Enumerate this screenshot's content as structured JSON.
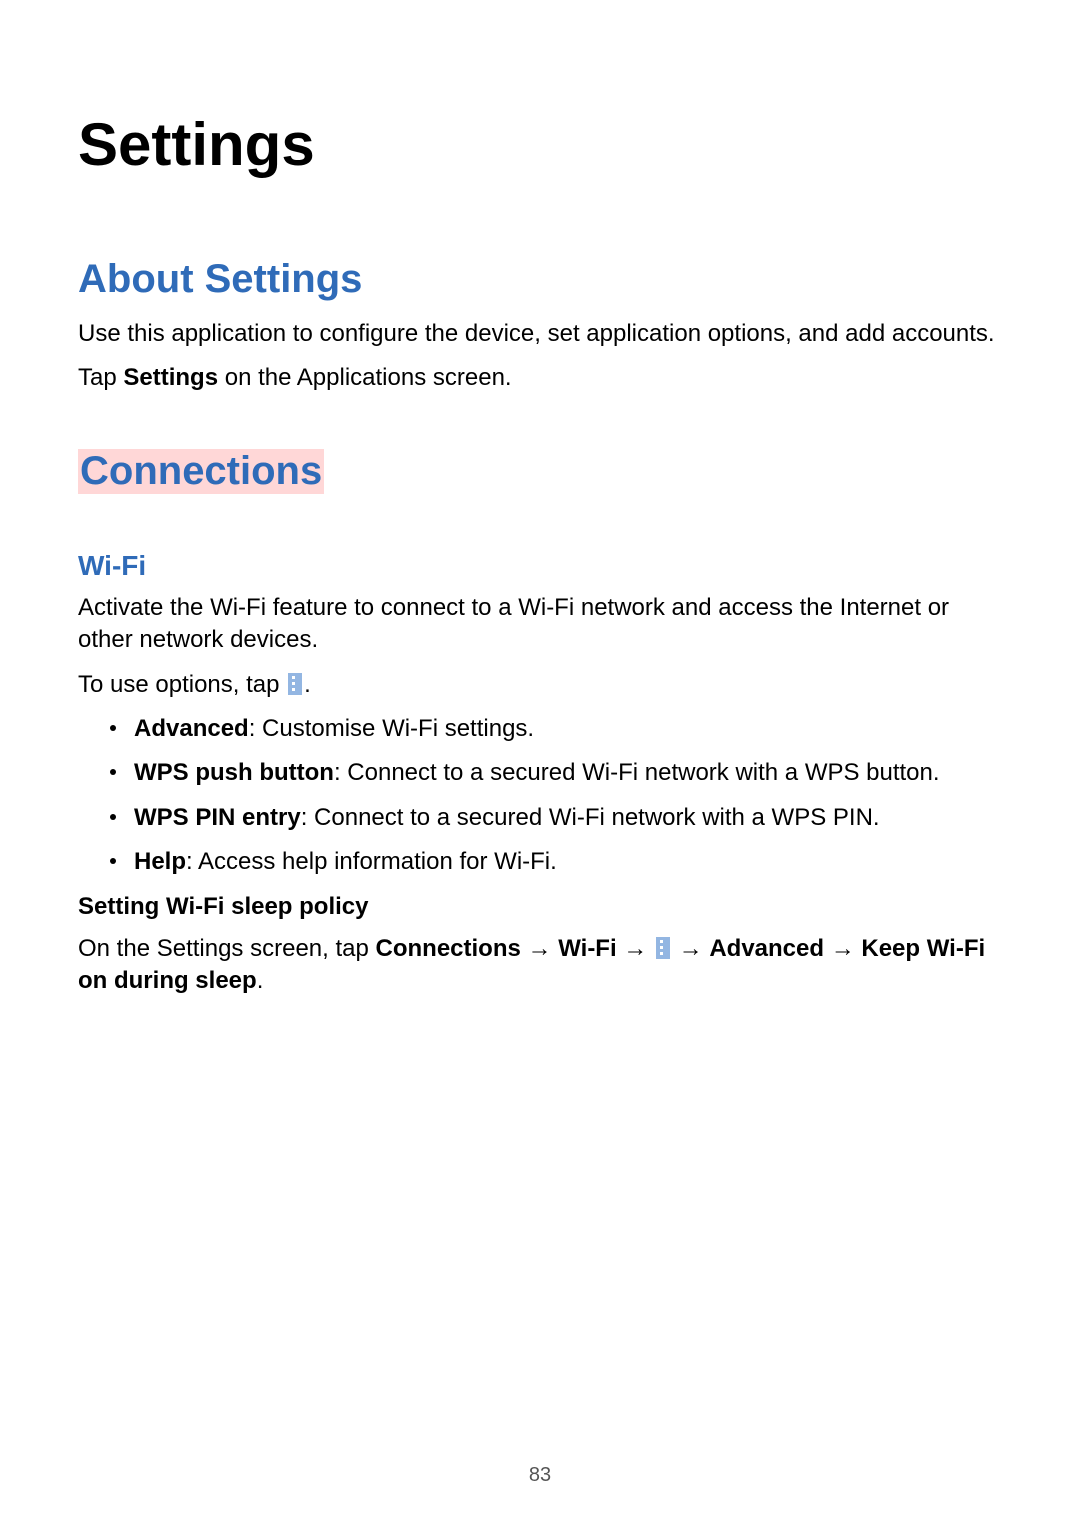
{
  "page_title": "Settings",
  "about": {
    "heading": "About Settings",
    "p1": "Use this application to configure the device, set application options, and add accounts.",
    "p2_prefix": "Tap ",
    "p2_bold": "Settings",
    "p2_suffix": " on the Applications screen."
  },
  "connections": {
    "heading": "Connections",
    "wifi": {
      "heading": "Wi-Fi",
      "intro": "Activate the Wi-Fi feature to connect to a Wi-Fi network and access the Internet or other network devices.",
      "options_prefix": "To use options, tap ",
      "options_suffix": ".",
      "bullets": [
        {
          "bold": "Advanced",
          "text": ": Customise Wi-Fi settings."
        },
        {
          "bold": "WPS push button",
          "text": ": Connect to a secured Wi-Fi network with a WPS button."
        },
        {
          "bold": "WPS PIN entry",
          "text": ": Connect to a secured Wi-Fi network with a WPS PIN."
        },
        {
          "bold": "Help",
          "text": ": Access help information for Wi-Fi."
        }
      ],
      "sleep_policy": {
        "heading": "Setting Wi-Fi sleep policy",
        "prefix": "On the Settings screen, tap ",
        "path1": "Connections",
        "arrow": " → ",
        "path2": "Wi-Fi",
        "path3": "Advanced",
        "path4": "Keep Wi-Fi on during sleep",
        "suffix": "."
      }
    }
  },
  "page_number": "83"
}
